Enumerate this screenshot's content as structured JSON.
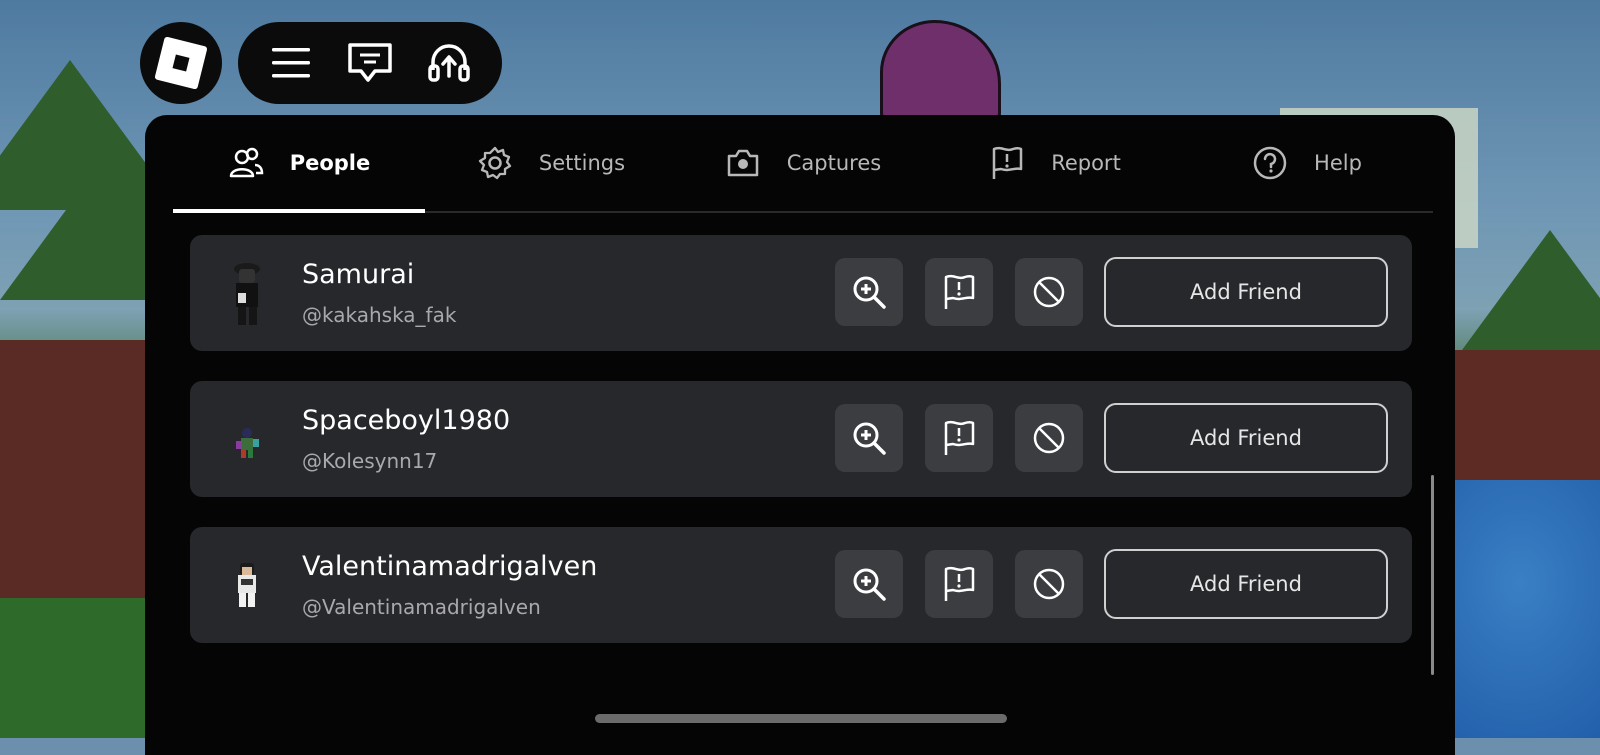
{
  "tabs": [
    {
      "label": "People",
      "icon": "people-icon",
      "active": true
    },
    {
      "label": "Settings",
      "icon": "gear-icon",
      "active": false
    },
    {
      "label": "Captures",
      "icon": "camera-icon",
      "active": false
    },
    {
      "label": "Report",
      "icon": "flag-icon",
      "active": false
    },
    {
      "label": "Help",
      "icon": "help-icon",
      "active": false
    }
  ],
  "players": [
    {
      "name": "Samurai",
      "handle": "@kakahska_fak",
      "action": "Add Friend"
    },
    {
      "name": "Spaceboyl1980",
      "handle": "@Kolesynn17",
      "action": "Add Friend"
    },
    {
      "name": "Valentinamadrigalven",
      "handle": "@Valentinamadrigalven",
      "action": "Add Friend"
    }
  ],
  "colors": {
    "panel": "#050505",
    "row": "#27282b",
    "icon_button": "#3c3d40",
    "text_primary": "#ffffff",
    "text_secondary": "#a9a9ad"
  }
}
